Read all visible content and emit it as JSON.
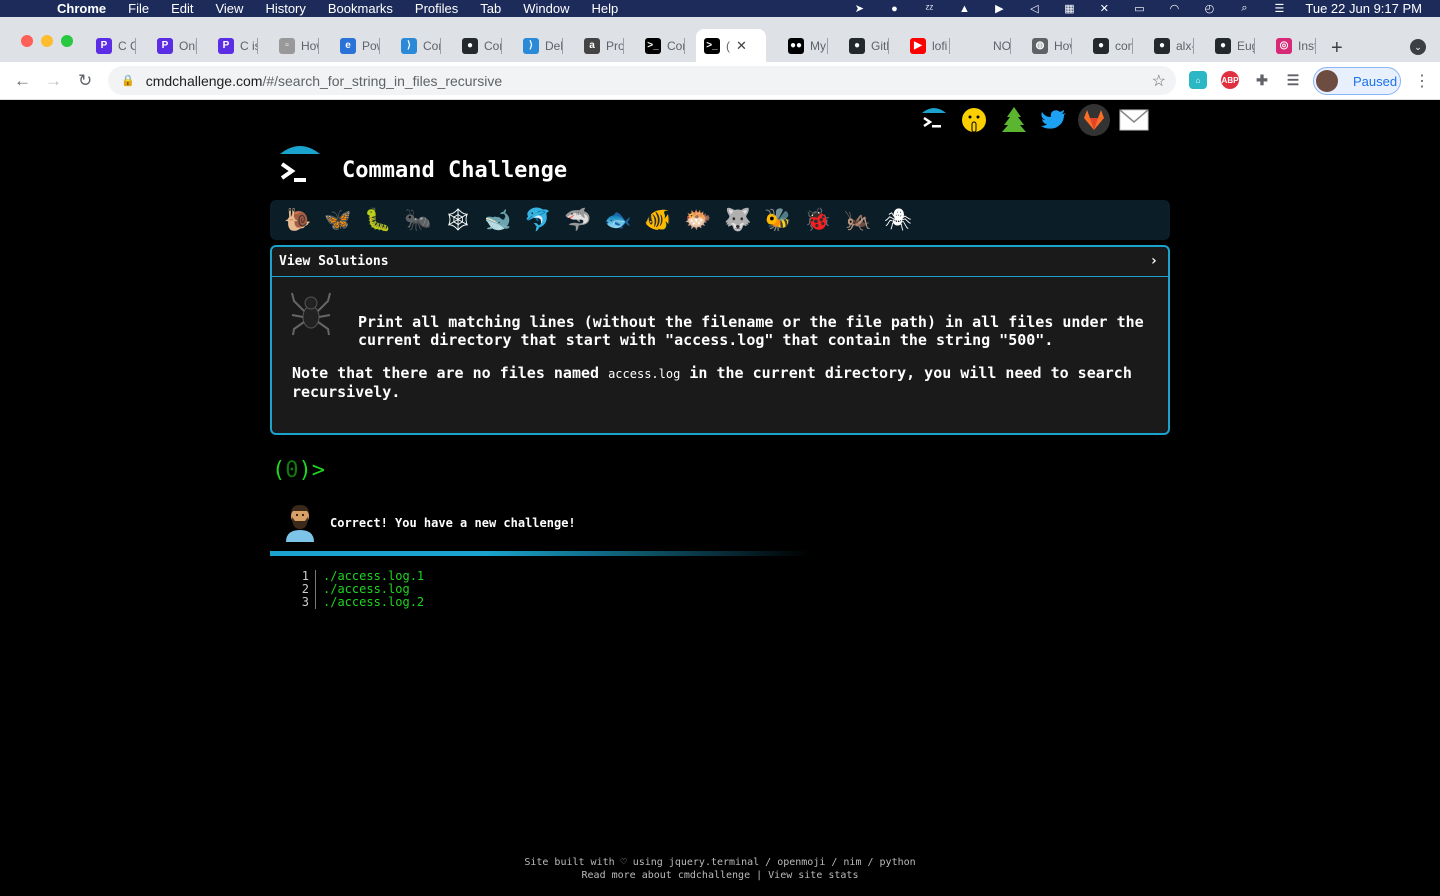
{
  "menubar": {
    "apple": "",
    "app": "Chrome",
    "items": [
      "File",
      "Edit",
      "View",
      "History",
      "Bookmarks",
      "Profiles",
      "Tab",
      "Window",
      "Help"
    ],
    "clock": "Tue 22 Jun  9:17 PM"
  },
  "tabs": [
    {
      "title": "C C",
      "icon": "p-logo-icon",
      "color": "#5b2ee6"
    },
    {
      "title": "Onli",
      "icon": "p-logo-icon",
      "color": "#5b2ee6"
    },
    {
      "title": "C is",
      "icon": "p-logo-icon",
      "color": "#5b2ee6"
    },
    {
      "title": "How",
      "icon": "page-icon",
      "color": "#999999"
    },
    {
      "title": "Pow",
      "icon": "e-logo-icon",
      "color": "#2a72d8"
    },
    {
      "title": "Con",
      "icon": "vscode-icon",
      "color": "#2a8ad8"
    },
    {
      "title": "Con",
      "icon": "github-icon",
      "color": "#24292e"
    },
    {
      "title": "Deb",
      "icon": "vscode-icon",
      "color": "#2a8ad8"
    },
    {
      "title": "Proj",
      "icon": "alx-icon",
      "color": "#444444"
    },
    {
      "title": "Con",
      "icon": "terminal-icon",
      "color": "#000000"
    },
    {
      "title": "(",
      "icon": "terminal-icon",
      "color": "#000000",
      "active": true
    },
    {
      "title": "My",
      "icon": "medium-icon",
      "color": "#000000"
    },
    {
      "title": "Gith",
      "icon": "github-icon",
      "color": "#24292e"
    },
    {
      "title": "lofi",
      "icon": "youtube-icon",
      "color": "#ff0000"
    },
    {
      "title": "NO\\",
      "icon": "blank-icon",
      "color": "#dee1e6"
    },
    {
      "title": "How",
      "icon": "globe-icon",
      "color": "#5f6368"
    },
    {
      "title": "con",
      "icon": "github-icon",
      "color": "#24292e"
    },
    {
      "title": "alx-",
      "icon": "github-icon",
      "color": "#24292e"
    },
    {
      "title": "Eug",
      "icon": "github-icon",
      "color": "#24292e"
    },
    {
      "title": "Inst",
      "icon": "instagram-icon",
      "color": "#d62976"
    }
  ],
  "address": {
    "host": "cmdchallenge.com",
    "path": "/#/search_for_string_in_files_recursive"
  },
  "profile": {
    "label": "Paused"
  },
  "site": {
    "title": "Command Challenge",
    "view_solutions": "View Solutions",
    "chevron": "›",
    "description": "Print all matching lines (without the filename or the file path) in all files under the current directory that start with \"access.log\" that contain the string \"500\".",
    "note_before": "Note that there are no files named ",
    "note_code": "access.log",
    "note_after": " in the current directory, you will need to search recursively.",
    "prompt_open": "(",
    "prompt_count": "0",
    "prompt_close": ")>",
    "correct": "Correct! You have a new challenge!"
  },
  "output_lines": [
    {
      "n": "1",
      "text": "./access.log.1"
    },
    {
      "n": "2",
      "text": "./access.log"
    },
    {
      "n": "3",
      "text": "./access.log.2"
    }
  ],
  "footer": {
    "line1": "Site built with ♡ using jquery.terminal / openmoji / nim / python",
    "line2": "Read more about cmdchallenge | View site stats"
  },
  "challenge_icons": [
    "snail-icon",
    "butterfly-icon",
    "caterpillar-icon",
    "ant-icon",
    "web-icon",
    "whale-icon",
    "dolphin-icon",
    "shark-icon",
    "fish-icon",
    "tropical-fish-icon",
    "blowfish-icon",
    "wolf-icon",
    "bee-icon",
    "ladybug-icon",
    "cricket-icon",
    "spider-icon"
  ],
  "colors": {
    "accent": "#1aa3cc",
    "terminal_green": "#1fd61f"
  }
}
